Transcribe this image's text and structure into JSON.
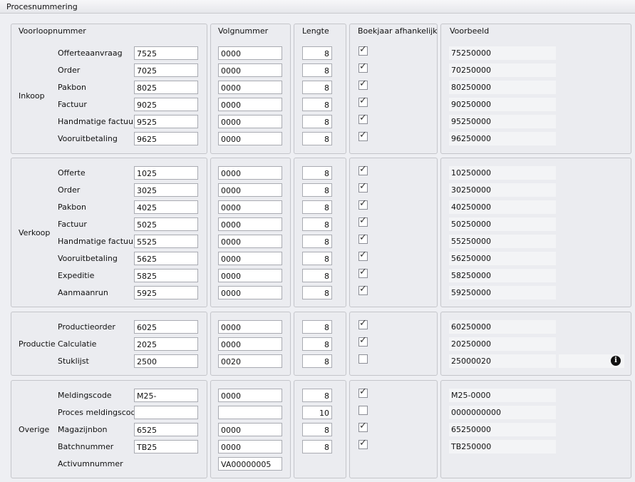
{
  "title": "Procesnummering",
  "headers": {
    "voorloopnummer": "Voorloopnummer",
    "volgnummer": "Volgnummer",
    "lengte": "Lengte",
    "boekjaar": "Boekjaar afhankelijk",
    "voorbeeld": "Voorbeeld"
  },
  "sections": {
    "inkoop": {
      "label": "Inkoop",
      "rows": [
        {
          "label": "Offerteaanvraag",
          "voor": "7525",
          "volg": "0000",
          "len": "8",
          "boekjaar": true,
          "voorbeeld": "75250000"
        },
        {
          "label": "Order",
          "voor": "7025",
          "volg": "0000",
          "len": "8",
          "boekjaar": true,
          "voorbeeld": "70250000"
        },
        {
          "label": "Pakbon",
          "voor": "8025",
          "volg": "0000",
          "len": "8",
          "boekjaar": true,
          "voorbeeld": "80250000"
        },
        {
          "label": "Factuur",
          "voor": "9025",
          "volg": "0000",
          "len": "8",
          "boekjaar": true,
          "voorbeeld": "90250000"
        },
        {
          "label": "Handmatige factuur",
          "voor": "9525",
          "volg": "0000",
          "len": "8",
          "boekjaar": true,
          "voorbeeld": "95250000"
        },
        {
          "label": "Vooruitbetaling",
          "voor": "9625",
          "volg": "0000",
          "len": "8",
          "boekjaar": true,
          "voorbeeld": "96250000"
        }
      ]
    },
    "verkoop": {
      "label": "Verkoop",
      "rows": [
        {
          "label": "Offerte",
          "voor": "1025",
          "volg": "0000",
          "len": "8",
          "boekjaar": true,
          "voorbeeld": "10250000"
        },
        {
          "label": "Order",
          "voor": "3025",
          "volg": "0000",
          "len": "8",
          "boekjaar": true,
          "voorbeeld": "30250000"
        },
        {
          "label": "Pakbon",
          "voor": "4025",
          "volg": "0000",
          "len": "8",
          "boekjaar": true,
          "voorbeeld": "40250000"
        },
        {
          "label": "Factuur",
          "voor": "5025",
          "volg": "0000",
          "len": "8",
          "boekjaar": true,
          "voorbeeld": "50250000"
        },
        {
          "label": "Handmatige factuur",
          "voor": "5525",
          "volg": "0000",
          "len": "8",
          "boekjaar": true,
          "voorbeeld": "55250000"
        },
        {
          "label": "Vooruitbetaling",
          "voor": "5625",
          "volg": "0000",
          "len": "8",
          "boekjaar": true,
          "voorbeeld": "56250000"
        },
        {
          "label": "Expeditie",
          "voor": "5825",
          "volg": "0000",
          "len": "8",
          "boekjaar": true,
          "voorbeeld": "58250000"
        },
        {
          "label": "Aanmaanrun",
          "voor": "5925",
          "volg": "0000",
          "len": "8",
          "boekjaar": true,
          "voorbeeld": "59250000"
        }
      ]
    },
    "productie": {
      "label": "Productie",
      "rows": [
        {
          "label": "Productieorder",
          "voor": "6025",
          "volg": "0000",
          "len": "8",
          "boekjaar": true,
          "voorbeeld": "60250000"
        },
        {
          "label": "Calculatie",
          "voor": "2025",
          "volg": "0000",
          "len": "8",
          "boekjaar": true,
          "voorbeeld": "20250000"
        },
        {
          "label": "Stuklijst",
          "voor": "2500",
          "volg": "0020",
          "len": "8",
          "boekjaar": false,
          "voorbeeld": "25000020"
        }
      ]
    },
    "overige": {
      "label": "Overige",
      "rows": [
        {
          "label": "Meldingscode",
          "voor": "M25-",
          "volg": "0000",
          "len": "8",
          "boekjaar": true,
          "voorbeeld": "M25-0000"
        },
        {
          "label": "Proces meldingscode",
          "voor": "",
          "volg": "",
          "len": "10",
          "boekjaar": false,
          "voorbeeld": "0000000000"
        },
        {
          "label": "Magazijnbon",
          "voor": "6525",
          "volg": "0000",
          "len": "8",
          "boekjaar": true,
          "voorbeeld": "65250000"
        },
        {
          "label": "Batchnummer",
          "voor": "TB25",
          "volg": "0000",
          "len": "8",
          "boekjaar": true,
          "voorbeeld": "TB250000"
        },
        {
          "label": "Activumnummer",
          "volg": "VA00000005"
        }
      ]
    }
  },
  "icons": {
    "info": "info-icon"
  },
  "info_glyph": "i"
}
